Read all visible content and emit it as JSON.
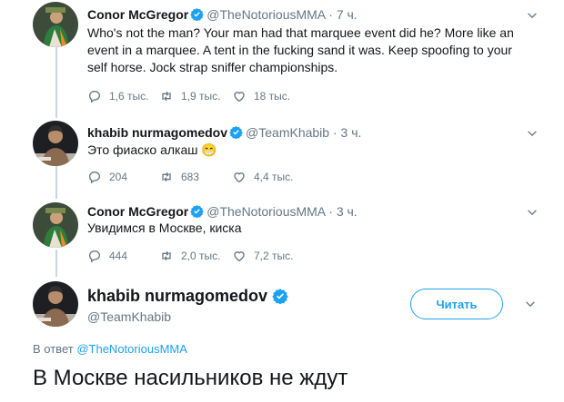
{
  "colors": {
    "accent": "#1da1f2",
    "text": "#14171a",
    "muted": "#657786",
    "border": "#ccd6dd"
  },
  "tweets": [
    {
      "name": "Conor McGregor",
      "handle": "@TheNotoriousMMA",
      "time": "· 7 ч.",
      "text": "Who's not the man? Your man had that marquee event did he? More like an event in a marquee. A tent in the fucking sand it was. Keep spoofing to your self horse. Jock strap sniffer championships.",
      "replies": "1,6 тыс.",
      "retweets": "1,9 тыс.",
      "likes": "18 тыс."
    },
    {
      "name": "khabib nurmagomedov",
      "handle": "@TeamKhabib",
      "time": "· 3 ч.",
      "text": "Это фиаско алкаш",
      "emoji": "😁",
      "replies": "204",
      "retweets": "683",
      "likes": "4,4 тыс."
    },
    {
      "name": "Conor McGregor",
      "handle": "@TheNotoriousMMA",
      "time": "· 3 ч.",
      "text": "Увидимся в Москве, киска",
      "replies": "444",
      "retweets": "2,0 тыс.",
      "likes": "7,2 тыс."
    }
  ],
  "main_tweet": {
    "name": "khabib nurmagomedov",
    "handle": "@TeamKhabib",
    "follow_label": "Читать",
    "reply_prefix": "В ответ",
    "reply_handle": "@TheNotoriousMMA",
    "text": "В Москве насильников не ждут"
  }
}
